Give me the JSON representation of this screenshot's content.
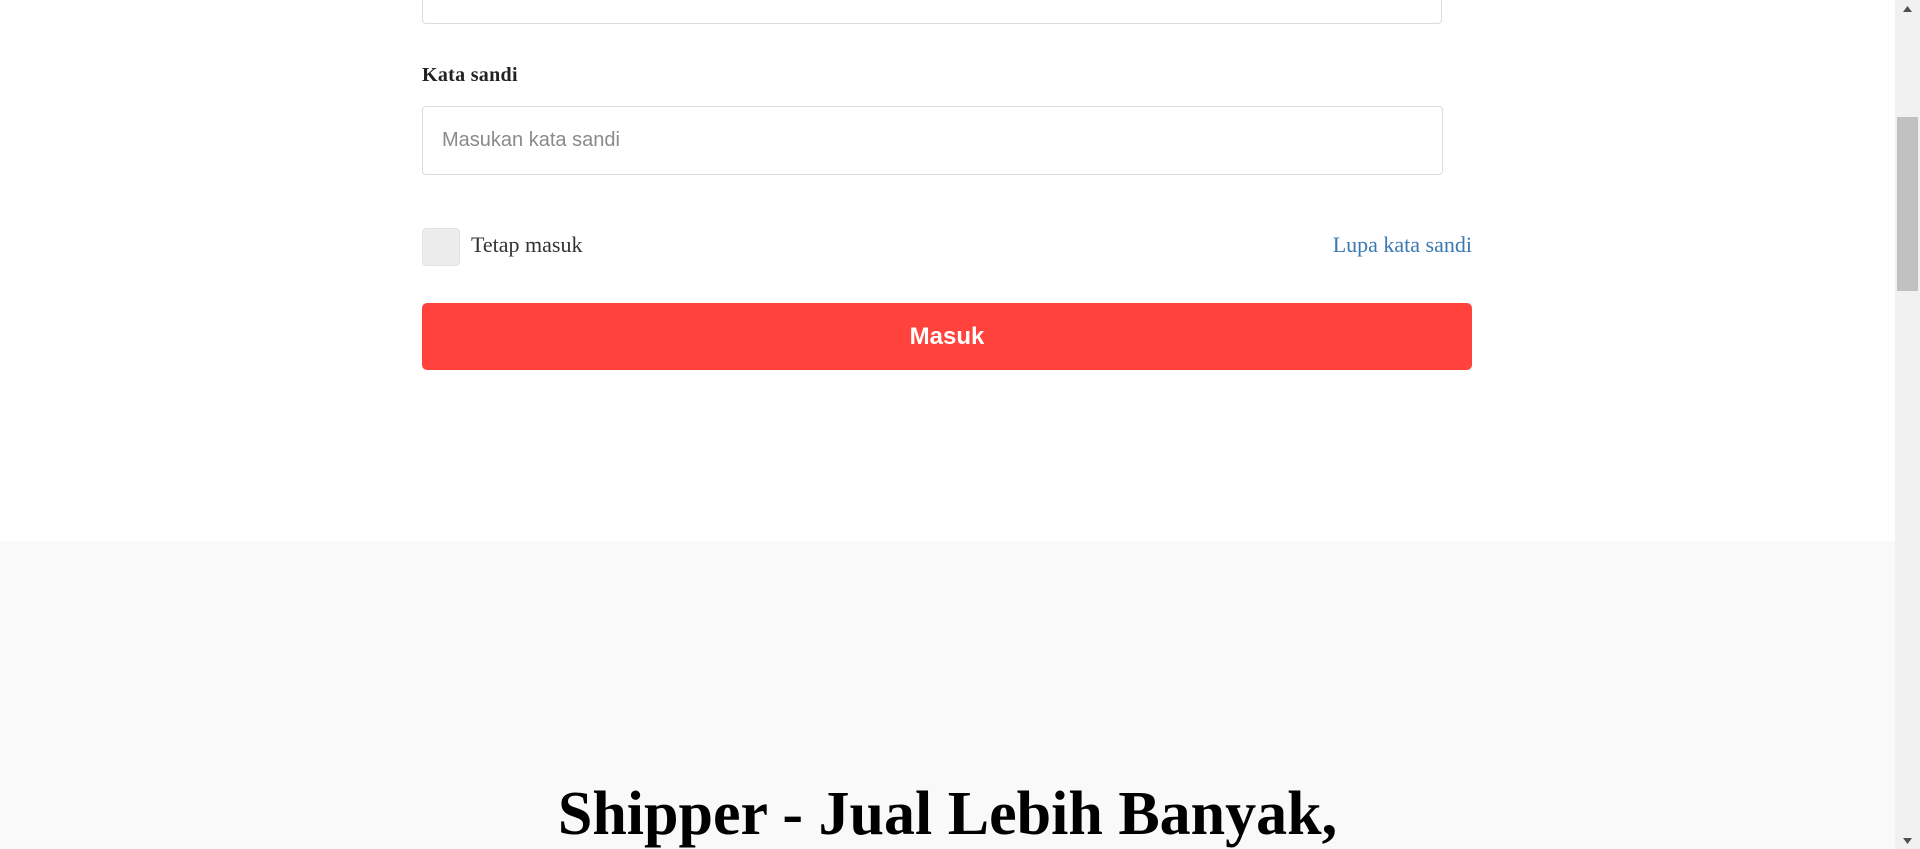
{
  "login_form": {
    "password_label": "Kata sandi",
    "password_placeholder": "Masukan kata sandi",
    "remember_label": "Tetap masuk",
    "forgot_password_link": "Lupa kata sandi",
    "submit_label": "Masuk"
  },
  "hero": {
    "title": "Shipper - Jual Lebih Banyak,"
  },
  "colors": {
    "primary_button": "#ff433c",
    "link": "#3a78b4",
    "section_background": "#f9f9f9"
  },
  "icons": {
    "scroll_up": "scroll-up-arrow-icon",
    "scroll_down": "scroll-down-arrow-icon"
  }
}
